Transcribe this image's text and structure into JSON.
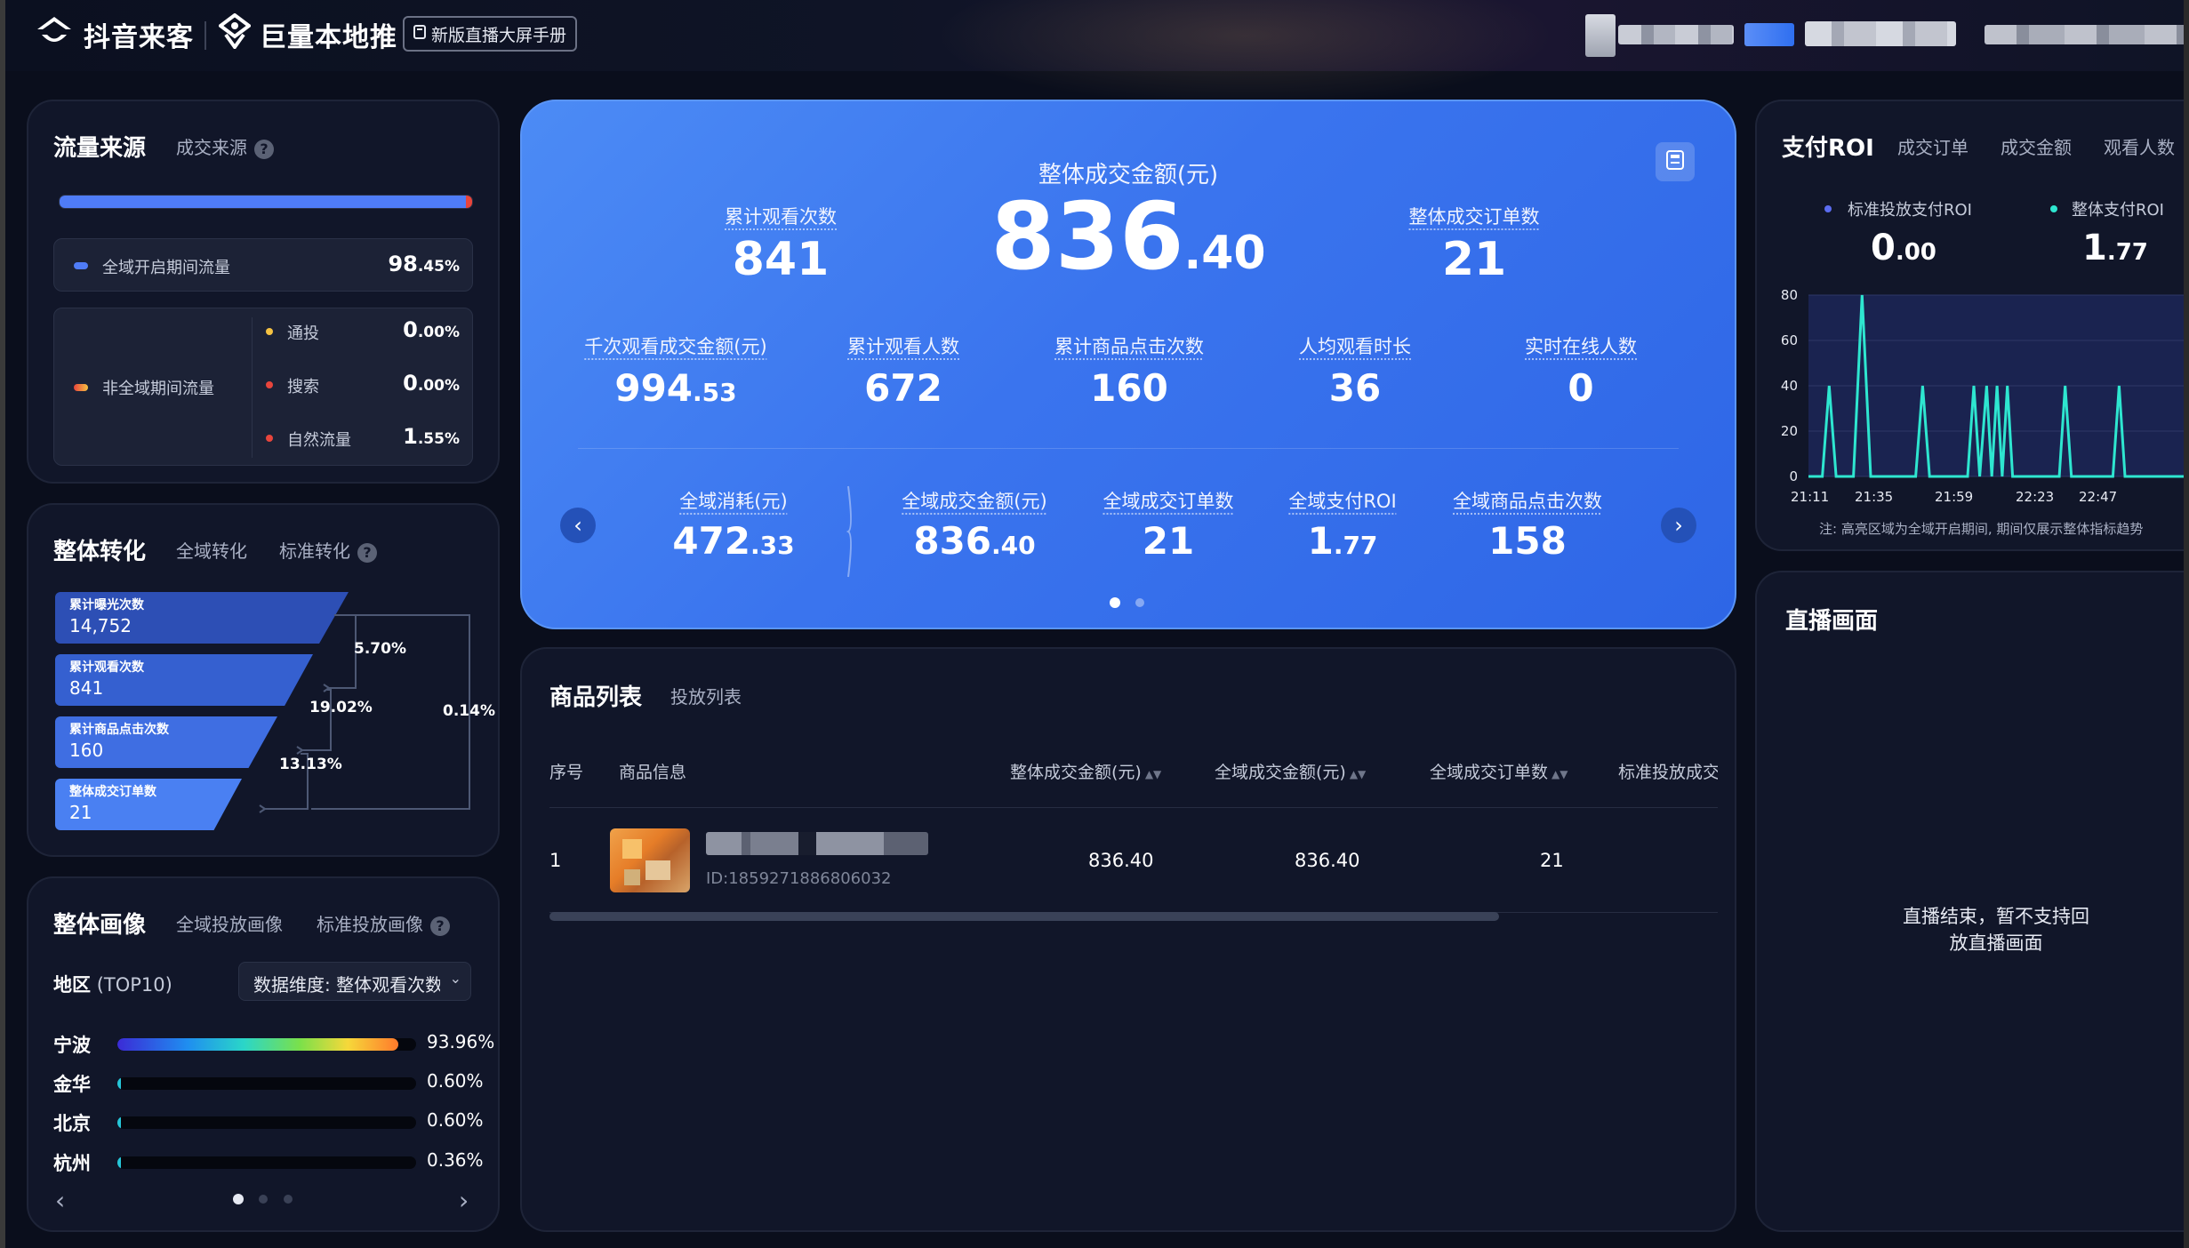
{
  "topbar": {
    "brand1": "抖音来客",
    "brand2": "巨量本地推",
    "manual_button": "新版直播大屏手册"
  },
  "traffic": {
    "title": "流量来源",
    "tab": "成交来源",
    "full_domain_label": "全域开启期间流量",
    "full_domain_value": "98",
    "full_domain_decimal": ".45%",
    "non_full_label": "非全域期间流量",
    "items": [
      {
        "label": "通投",
        "value": "0",
        "decimal": ".00%"
      },
      {
        "label": "搜索",
        "value": "0",
        "decimal": ".00%"
      },
      {
        "label": "自然流量",
        "value": "1",
        "decimal": ".55%"
      }
    ],
    "bar_fraction": 0.9845,
    "colors": {
      "blue": "#4f7cf7",
      "red": "#e8453c",
      "yellow": "#f5c242"
    }
  },
  "conversion": {
    "title": "整体转化",
    "tabs": [
      "全域转化",
      "标准转化"
    ],
    "funnel": [
      {
        "label": "累计曝光次数",
        "value": "14,752"
      },
      {
        "label": "累计观看次数",
        "value": "841"
      },
      {
        "label": "累计商品点击次数",
        "value": "160"
      },
      {
        "label": "整体成交订单数",
        "value": "21"
      }
    ],
    "rates": [
      "5.70%",
      "19.02%",
      "13.13%"
    ],
    "overall_rate": "0.14%"
  },
  "portrait": {
    "title": "整体画像",
    "tabs": [
      "全域投放画像",
      "标准投放画像"
    ],
    "region_label": "地区",
    "region_sub": "(TOP10)",
    "dimension_select": "数据维度: 整体观看次数",
    "regions": [
      {
        "name": "宁波",
        "pct": "93.96%",
        "value": 93.96
      },
      {
        "name": "金华",
        "pct": "0.60%",
        "value": 0.6
      },
      {
        "name": "北京",
        "pct": "0.60%",
        "value": 0.6
      },
      {
        "name": "杭州",
        "pct": "0.36%",
        "value": 0.36
      }
    ],
    "prev_icon": "‹",
    "next_icon": "›"
  },
  "hero": {
    "main_label": "整体成交金额(元)",
    "main_value": "836",
    "main_decimal": ".40",
    "left_label": "累计观看次数",
    "left_value": "841",
    "right_label": "整体成交订单数",
    "right_value": "21",
    "row2": [
      {
        "label": "千次观看成交金额(元)",
        "value": "994",
        "decimal": ".53"
      },
      {
        "label": "累计观看人数",
        "value": "672",
        "decimal": ""
      },
      {
        "label": "累计商品点击次数",
        "value": "160",
        "decimal": ""
      },
      {
        "label": "人均观看时长",
        "value": "36",
        "decimal": ""
      },
      {
        "label": "实时在线人数",
        "value": "0",
        "decimal": ""
      }
    ],
    "row3": [
      {
        "label": "全域消耗(元)",
        "value": "472",
        "decimal": ".33"
      },
      {
        "label": "全域成交金额(元)",
        "value": "836",
        "decimal": ".40"
      },
      {
        "label": "全域成交订单数",
        "value": "21",
        "decimal": ""
      },
      {
        "label": "全域支付ROI",
        "value": "1",
        "decimal": ".77"
      },
      {
        "label": "全域商品点击次数",
        "value": "158",
        "decimal": ""
      }
    ],
    "prev_icon": "‹",
    "next_icon": "›"
  },
  "products": {
    "title": "商品列表",
    "tab": "投放列表",
    "columns": [
      "序号",
      "商品信息",
      "整体成交金额(元)",
      "全域成交金额(元)",
      "全域成交订单数",
      "标准投放成交"
    ],
    "rows": [
      {
        "index": "1",
        "id": "ID:1859271886806032",
        "total_amount": "836.40",
        "full_amount": "836.40",
        "full_orders": "21"
      }
    ]
  },
  "roi": {
    "title": "支付ROI",
    "tabs": [
      "成交订单",
      "成交金额",
      "观看人数"
    ],
    "legend": [
      {
        "label": "标准投放支付ROI",
        "value": "0",
        "decimal": ".00",
        "color": "#5b6cf0"
      },
      {
        "label": "整体支付ROI",
        "value": "1",
        "decimal": ".77",
        "color": "#2ee6d0"
      }
    ],
    "note": "注: 高亮区域为全域开启期间, 期间仅展示整体指标趋势"
  },
  "chart_data": {
    "type": "line",
    "x_ticks": [
      "21:11",
      "21:35",
      "21:59",
      "22:23",
      "22:47"
    ],
    "y_ticks": [
      "0",
      "20",
      "40",
      "60",
      "80"
    ],
    "ylim": [
      0,
      80
    ],
    "series": [
      {
        "name": "整体支付ROI",
        "color": "#2ee6d0",
        "points": [
          [
            0,
            0
          ],
          [
            0.4,
            0
          ],
          [
            0.6,
            40
          ],
          [
            0.8,
            0
          ],
          [
            1.3,
            0
          ],
          [
            1.55,
            80
          ],
          [
            1.8,
            0
          ],
          [
            3.1,
            0
          ],
          [
            3.3,
            40
          ],
          [
            3.5,
            0
          ],
          [
            4.6,
            0
          ],
          [
            4.78,
            40
          ],
          [
            4.95,
            0
          ],
          [
            5.15,
            40
          ],
          [
            5.3,
            0
          ],
          [
            5.45,
            40
          ],
          [
            5.6,
            0
          ],
          [
            5.75,
            40
          ],
          [
            5.9,
            0
          ],
          [
            7.25,
            0
          ],
          [
            7.42,
            40
          ],
          [
            7.6,
            0
          ],
          [
            8.8,
            0
          ],
          [
            8.98,
            40
          ],
          [
            9.15,
            0
          ],
          [
            11,
            0
          ]
        ]
      }
    ],
    "x_max": 11
  },
  "live": {
    "title": "直播画面",
    "message": "直播结束，暂不支持回放直播画面"
  }
}
